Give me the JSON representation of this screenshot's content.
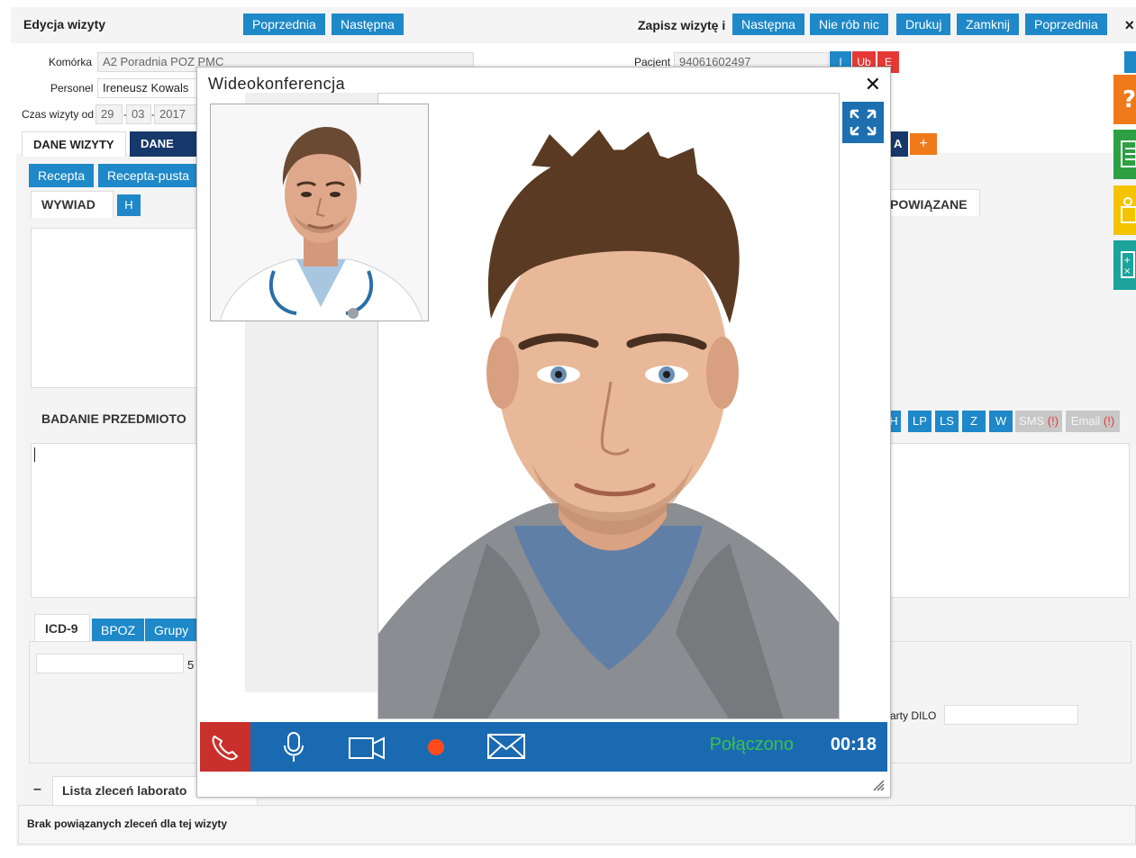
{
  "header": {
    "title": "Edycja wizyty",
    "prev_label": "Poprzednia",
    "next_label": "Następna",
    "save_label": "Zapisz wizytę i",
    "save_next_label": "Następna",
    "nothing_label": "Nie rób nic",
    "print_label": "Drukuj",
    "close_label": "Zamknij",
    "save_prev_label": "Poprzednia",
    "close_icon": "×"
  },
  "form": {
    "komorka_label": "Komórka",
    "komorka_value": "A2 Poradnia POZ PMC",
    "personel_label": "Personel",
    "personel_value": "Ireneusz Kowals",
    "czas_label": "Czas wizyty od",
    "day": "29",
    "month": "03",
    "year": "2017",
    "sep1": "-",
    "sep2": "-",
    "pacjent_label": "Pacjent",
    "pacjent_value": "94061602497",
    "btn_i": "I",
    "btn_ub": "Ub",
    "btn_e": "E"
  },
  "tabs": {
    "dane_wizyty": "DANE WIZYTY",
    "dane_me": "DANE ME",
    "recepta": "Recepta",
    "recepta_pusta": "Recepta-pusta",
    "tab_a": "A",
    "plus": "+"
  },
  "sections": {
    "wywiad": "WYWIAD",
    "h_btn": "H",
    "powiazane": "POWIĄZANE",
    "badanie": "BADANIE PRZEDMIOTO",
    "icd9": "ICD-9",
    "bpoz": "BPOZ",
    "grupy": "Grupy",
    "icd_num": "5",
    "karty_dilo": "arty DILO",
    "lista_toggle": "–",
    "lista_title": "Lista zleceń laborato",
    "lista_empty": "Brak powiązanych zleceń dla tej wizyty"
  },
  "badanie_buttons": [
    "H",
    "LP",
    "LS",
    "Z",
    "W"
  ],
  "badanie_sms": "SMS",
  "badanie_sms_flag": "(!)",
  "badanie_email": "Email",
  "badanie_email_flag": "(!)",
  "modal": {
    "title": "Wideokonferencja",
    "close_icon": "✕",
    "status": "Połączono",
    "timer": "00:18"
  },
  "colors": {
    "primary": "#1e88c8",
    "dark_navy": "#16386a",
    "hangup_red": "#c9302c",
    "bar_blue": "#1a6ab2",
    "status_green": "#3cc04a",
    "orange": "#f07a1a"
  }
}
